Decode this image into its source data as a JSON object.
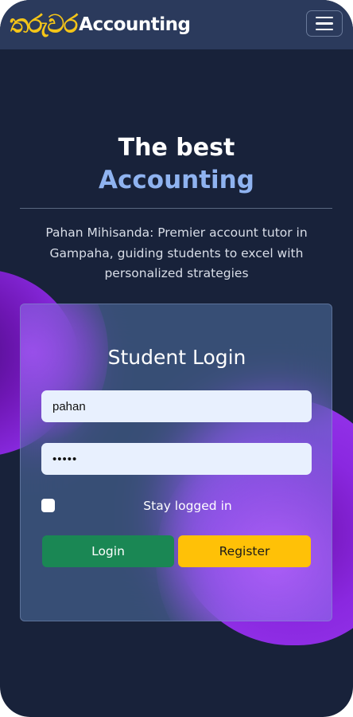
{
  "navbar": {
    "brand_script": "තරුවර",
    "brand_text": "Accounting",
    "menu_icon": "hamburger-menu-icon"
  },
  "hero": {
    "title": "The best",
    "accent": "Accounting",
    "tagline": "Pahan Mihisanda: Premier account tutor in Gampaha, guiding students to excel with personalized strategies"
  },
  "login": {
    "title": "Student Login",
    "username_value": "pahan",
    "password_value": "•••••",
    "remember_label": "Stay logged in",
    "remember_checked": false,
    "login_label": "Login",
    "register_label": "Register"
  },
  "colors": {
    "background": "#18223a",
    "navbar": "#2b3a5c",
    "accent_text": "#8fb3f0",
    "brand_yellow": "#f5c518",
    "login_button": "#1a8754",
    "register_button": "#ffc107",
    "blob_purple": "#8a2be2"
  }
}
